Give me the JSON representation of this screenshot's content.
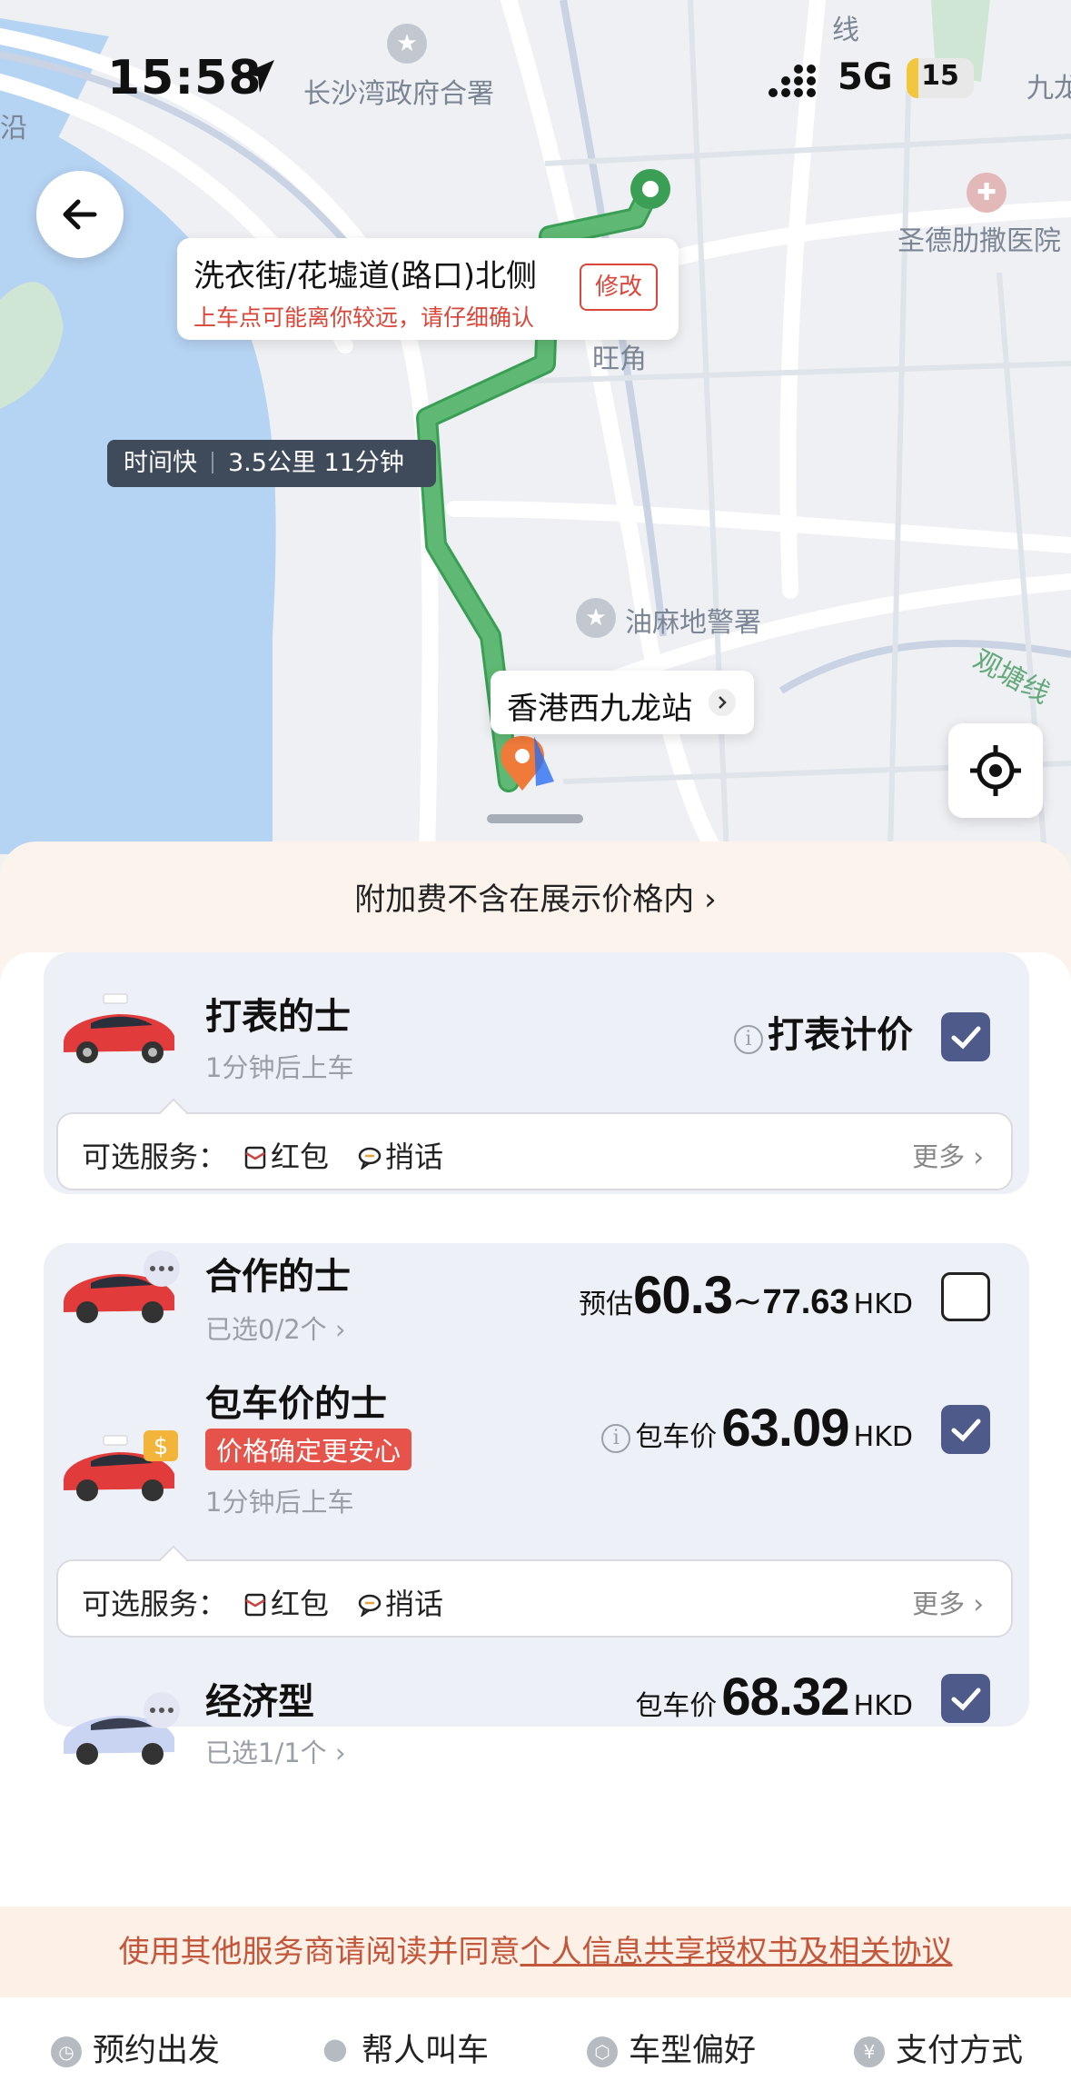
{
  "status_bar": {
    "time": "15:58",
    "network": "5G",
    "battery": "15"
  },
  "map": {
    "labels": {
      "changsha_bay": "长沙湾政府合署",
      "stteresa": "圣德肋撒医院",
      "yaumatei": "油麻地警署",
      "wangyung": "旺角",
      "kwuntong": "观塘线",
      "line_top": "线",
      "kowloon_partial": "九龙",
      "coast_partial": "沿"
    },
    "pickup": {
      "title": "洗衣街/花墟道(路口)北侧",
      "warning": "上车点可能离你较远，请仔细确认",
      "edit": "修改"
    },
    "route_tag": {
      "mode": "时间快",
      "detail": "3.5公里 11分钟"
    },
    "destination": "香港西九龙站"
  },
  "sheet": {
    "surcharge_note": "附加费不含在展示价格内 ›",
    "options": [
      {
        "name": "打表的士",
        "sub": "1分钟后上车",
        "price_text": "打表计价",
        "checked": true
      },
      {
        "name": "合作的士",
        "sub": "已选0/2个 ›",
        "price_label": "预估",
        "price_low": "60.3",
        "price_sep": "~",
        "price_high": "77.63",
        "unit": "HKD",
        "checked": false
      },
      {
        "name": "包车价的士",
        "badge": "价格确定更安心",
        "sub": "1分钟后上车",
        "price_label": "包车价",
        "price": "63.09",
        "unit": "HKD",
        "checked": true
      },
      {
        "name": "经济型",
        "sub": "已选1/1个 ›",
        "price_label": "包车价",
        "price": "68.32",
        "unit": "HKD",
        "checked": true
      }
    ],
    "services": {
      "label": "可选服务：",
      "red_packet": "红包",
      "message": "捎话",
      "more": "更多 ›"
    }
  },
  "consent": {
    "prefix": "使用其他服务商请阅读并同意",
    "link": "个人信息共享授权书及相关协议"
  },
  "bottom_bar": [
    {
      "label": "预约出发",
      "icon": "clock-icon"
    },
    {
      "label": "帮人叫车",
      "icon": "person-icon"
    },
    {
      "label": "车型偏好",
      "icon": "car-pref-icon"
    },
    {
      "label": "支付方式",
      "icon": "yen-icon"
    }
  ],
  "colors": {
    "accent": "#4e5a8a",
    "route": "#5fb873",
    "warning": "#d8473a",
    "water": "#b5d3f3"
  }
}
